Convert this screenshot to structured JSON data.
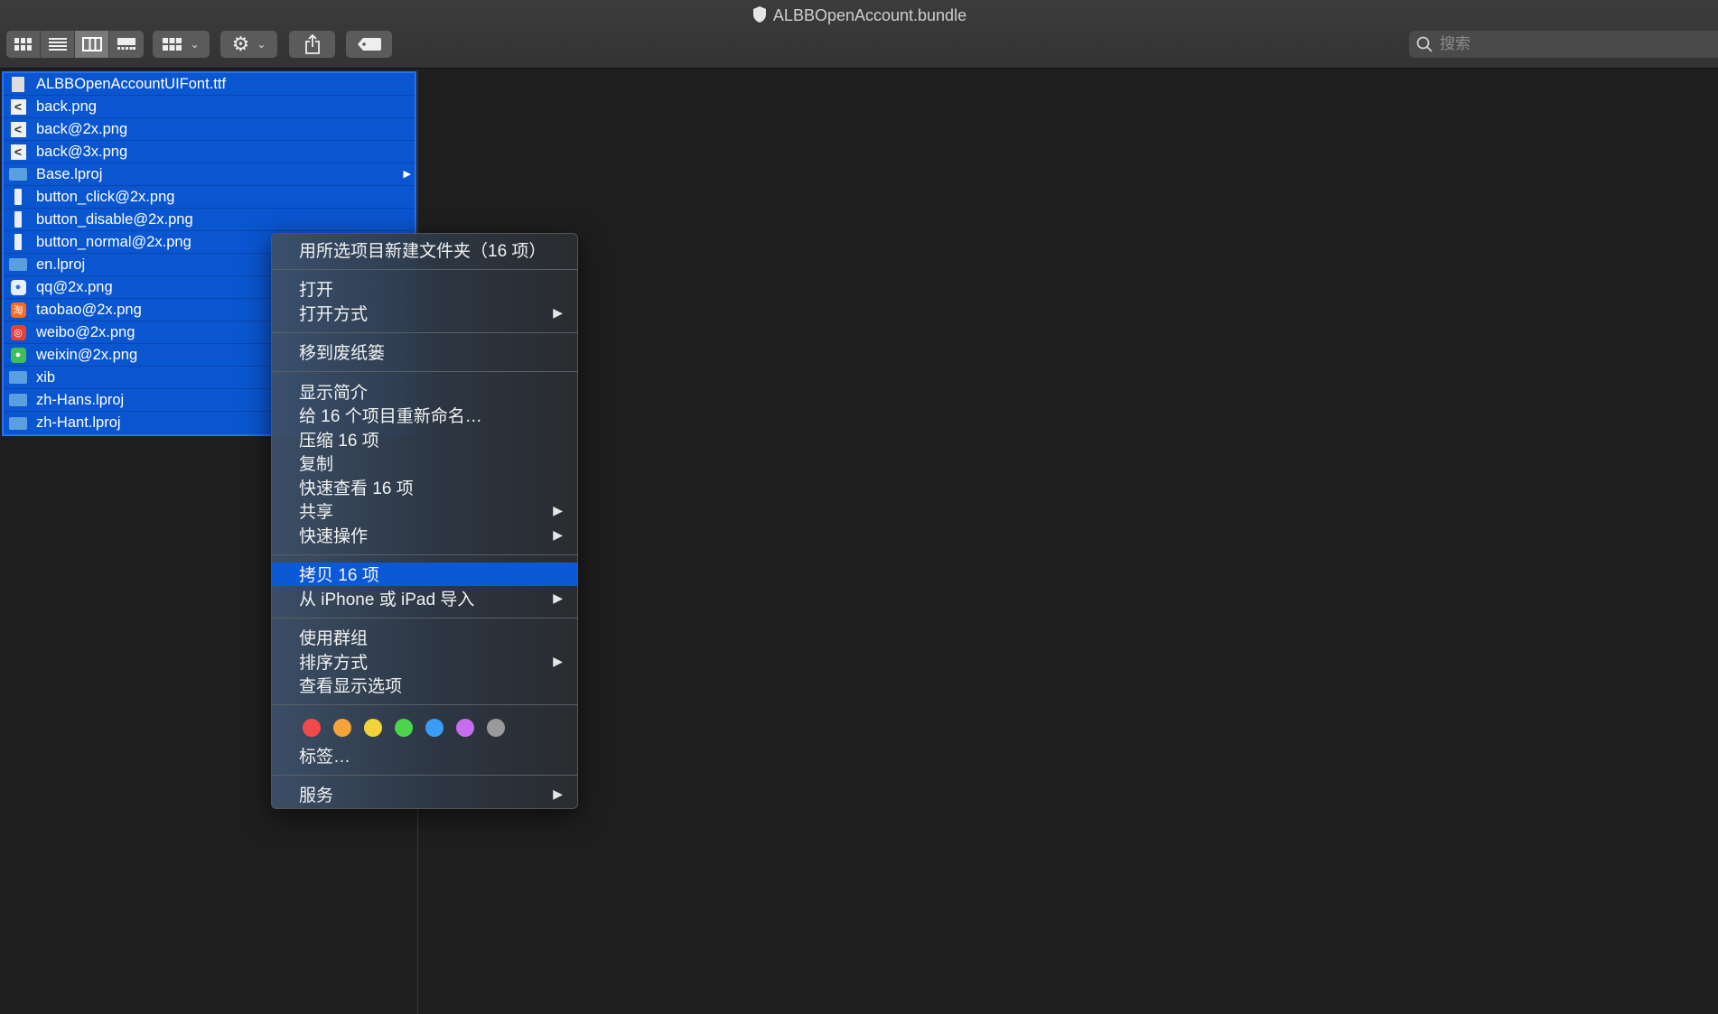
{
  "window": {
    "title": "ALBBOpenAccount.bundle"
  },
  "search": {
    "placeholder": "搜索"
  },
  "files": [
    {
      "name": "ALBBOpenAccountUIFont.ttf",
      "icon": "font-file-icon"
    },
    {
      "name": "back.png",
      "icon": "back-arrow-icon"
    },
    {
      "name": "back@2x.png",
      "icon": "back-arrow-icon"
    },
    {
      "name": "back@3x.png",
      "icon": "back-arrow-icon"
    },
    {
      "name": "Base.lproj",
      "icon": "folder-icon"
    },
    {
      "name": "button_click@2x.png",
      "icon": "image-file-icon"
    },
    {
      "name": "button_disable@2x.png",
      "icon": "image-file-icon"
    },
    {
      "name": "button_normal@2x.png",
      "icon": "image-file-icon"
    },
    {
      "name": "en.lproj",
      "icon": "folder-icon"
    },
    {
      "name": "qq@2x.png",
      "icon": "qq-icon"
    },
    {
      "name": "taobao@2x.png",
      "icon": "taobao-icon"
    },
    {
      "name": "weibo@2x.png",
      "icon": "weibo-icon"
    },
    {
      "name": "weixin@2x.png",
      "icon": "weixin-icon"
    },
    {
      "name": "xib",
      "icon": "folder-icon"
    },
    {
      "name": "zh-Hans.lproj",
      "icon": "folder-icon"
    },
    {
      "name": "zh-Hant.lproj",
      "icon": "folder-icon"
    }
  ],
  "menu": {
    "new_folder": "用所选项目新建文件夹（16 项）",
    "open": "打开",
    "open_with": "打开方式",
    "move_to_trash": "移到废纸篓",
    "get_info": "显示简介",
    "rename": "给 16 个项目重新命名…",
    "compress": "压缩 16 项",
    "duplicate": "复制",
    "quick_look": "快速查看 16 项",
    "share": "共享",
    "quick_actions": "快速操作",
    "copy": "拷贝 16 项",
    "import_iphone": "从 iPhone 或 iPad 导入",
    "use_groups": "使用群组",
    "sort_by": "排序方式",
    "view_options": "查看显示选项",
    "tags": "标签…",
    "services": "服务",
    "tag_colors": [
      "#f24a4a",
      "#f5a33a",
      "#f3d33a",
      "#4cd44c",
      "#3a9df5",
      "#c76ef0",
      "#9a9a9a"
    ]
  },
  "colors": {
    "selection": "#0a56d0",
    "highlight": "#0b59d7"
  }
}
